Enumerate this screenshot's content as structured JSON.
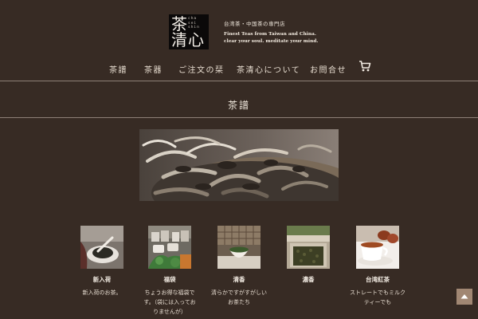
{
  "logo": {
    "kanji": [
      "茶",
      "清",
      "心"
    ],
    "romaji": "cha sei shin"
  },
  "tagline": {
    "jp": "台湾茶・中国茶の専門店",
    "en_line1": "Finest Teas from Taiwan and China.",
    "en_line2": "clear your soul. meditate your mind."
  },
  "nav": {
    "items": [
      "茶譜",
      "茶器",
      "ご注文の栞",
      "茶清心について",
      "お問合せ"
    ],
    "cart_icon": "shopping-cart-icon"
  },
  "section": {
    "title": "茶譜"
  },
  "hero": {
    "subject": "loose-leaf white tea in a dish"
  },
  "categories": [
    {
      "name": "新入荷",
      "desc": "新入荷のお茶。"
    },
    {
      "name": "福袋",
      "desc_1": "ちょうお得な福袋で",
      "desc_2": "す。（袋には入ってお",
      "desc_3": "りませんが）"
    },
    {
      "name": "清香",
      "desc_1": "清らかですがすがしい",
      "desc_2": "お茶たち"
    },
    {
      "name": "濃香",
      "desc": ""
    },
    {
      "name": "台湾紅茶",
      "desc_1": "ストレートでもミルク",
      "desc_2": "ティーでも"
    }
  ],
  "back_to_top_icon": "arrow-up-icon",
  "colors": {
    "background": "#372b24",
    "text": "#efe7dc",
    "rule": "#8e8077",
    "accent": "#a18773"
  }
}
